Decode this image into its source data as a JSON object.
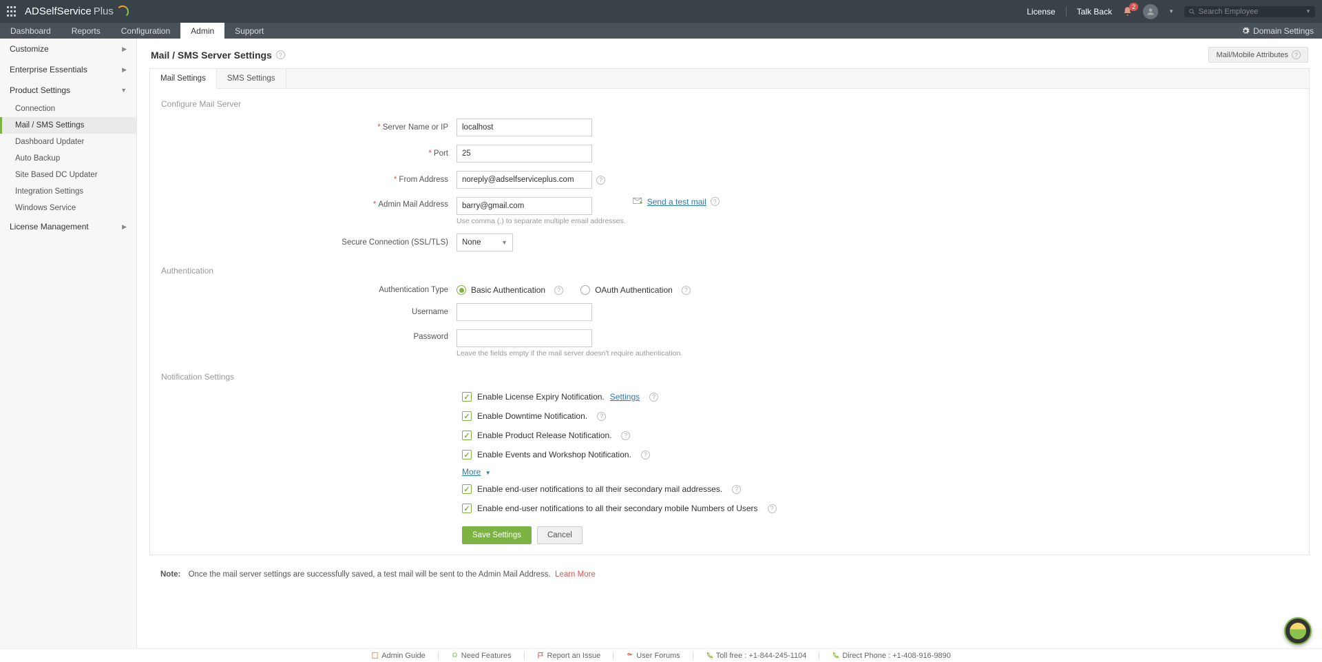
{
  "header": {
    "logo_main": "ADSelfService",
    "logo_suffix": "Plus",
    "links": {
      "license": "License",
      "talkback": "Talk Back"
    },
    "notifications_count": "2",
    "search_placeholder": "Search Employee"
  },
  "nav": {
    "dashboard": "Dashboard",
    "reports": "Reports",
    "configuration": "Configuration",
    "admin": "Admin",
    "support": "Support",
    "domain_settings": "Domain Settings"
  },
  "sidebar": {
    "customize": "Customize",
    "enterprise": "Enterprise Essentials",
    "product_settings": "Product Settings",
    "subs": {
      "connection": "Connection",
      "mail_sms": "Mail / SMS Settings",
      "dashboard_updater": "Dashboard Updater",
      "auto_backup": "Auto Backup",
      "site_dc": "Site Based DC Updater",
      "integration": "Integration Settings",
      "windows_service": "Windows Service"
    },
    "license_mgmt": "License Management"
  },
  "page": {
    "title": "Mail / SMS Server Settings",
    "mail_mobile_attr": "Mail/Mobile Attributes"
  },
  "tabs": {
    "mail": "Mail Settings",
    "sms": "SMS Settings"
  },
  "sections": {
    "config": "Configure Mail Server",
    "auth": "Authentication",
    "notif": "Notification Settings"
  },
  "form": {
    "server_label": "Server Name or IP",
    "server_value": "localhost",
    "port_label": "Port",
    "port_value": "25",
    "from_label": "From Address",
    "from_value": "noreply@adselfserviceplus.com",
    "admin_label": "Admin Mail Address",
    "admin_value": "barry@gmail.com",
    "admin_help": "Use comma (,) to separate multiple email addresses.",
    "test_mail": "Send a test mail",
    "secure_label": "Secure Connection (SSL/TLS)",
    "secure_value": "None",
    "auth_type_label": "Authentication Type",
    "auth_basic": "Basic Authentication",
    "auth_oauth": "OAuth Authentication",
    "username_label": "Username",
    "password_label": "Password",
    "password_help": "Leave the fields empty if the mail server doesn't require authentication."
  },
  "notif": {
    "license_expiry": "Enable License Expiry Notification.",
    "settings_link": "Settings",
    "downtime": "Enable Downtime Notification.",
    "product_release": "Enable Product Release Notification.",
    "events_workshop": "Enable Events and Workshop Notification.",
    "more": "More",
    "secondary_mail": "Enable end-user notifications to all their secondary mail addresses.",
    "secondary_mobile": "Enable end-user notifications to all their secondary mobile Numbers of Users"
  },
  "buttons": {
    "save": "Save Settings",
    "cancel": "Cancel"
  },
  "note": {
    "label": "Note:",
    "text": "Once the mail server settings are successfully saved, a test mail will be sent to the Admin Mail Address.",
    "learn_more": "Learn More"
  },
  "footer": {
    "admin_guide": "Admin Guide",
    "need_features": "Need Features",
    "report_issue": "Report an Issue",
    "user_forums": "User Forums",
    "toll_free": "Toll free : +1-844-245-1104",
    "direct_phone": "Direct Phone : +1-408-916-9890"
  }
}
